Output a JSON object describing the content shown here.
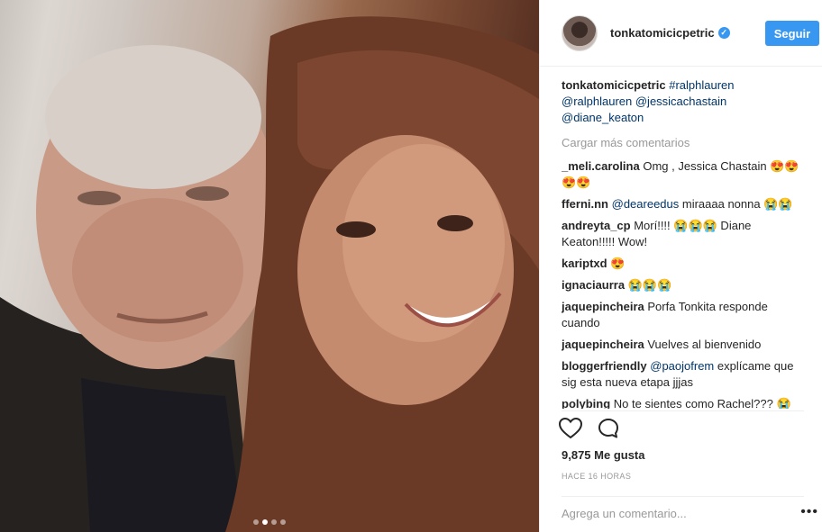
{
  "photo": {
    "carousel_dots": 4,
    "active_dot": 1
  },
  "header": {
    "username": "tonkatomicicpetric",
    "follow_label": "Seguir"
  },
  "caption": {
    "user": "tonkatomicicpetric",
    "tags": "#ralphlauren",
    "mentions": "@ralphlauren @jessicachastain @diane_keaton"
  },
  "load_more": "Cargar más comentarios",
  "comments": [
    {
      "user": "_meli.carolina",
      "text": " Omg , Jessica Chastain 😍😍😍😍"
    },
    {
      "user": "fferni.nn",
      "mention": "@deareedus",
      "text": " miraaaa nonna 😭😭"
    },
    {
      "user": "andreyta_cp",
      "text": " Morí!!!! 😭😭😭 Diane Keaton!!!!! Wow!"
    },
    {
      "user": "kariptxd",
      "text": " 😍"
    },
    {
      "user": "ignaciaurra",
      "text": " 😭😭😭"
    },
    {
      "user": "jaquepincheira",
      "text": " Porfa Tonkita responde cuando"
    },
    {
      "user": "jaquepincheira",
      "text": " Vuelves al bienvenido"
    },
    {
      "user": "bloggerfriendly",
      "mention": "@paojofrem",
      "text": " explícame que sig esta nueva etapa jjjas"
    },
    {
      "user": "polybing",
      "text": " No te sientes como Rachel??? 😭"
    }
  ],
  "actions": {
    "like_icon": "heart-outline-icon",
    "comment_icon": "speech-bubble-icon"
  },
  "likes": "9,875 Me gusta",
  "time": "HACE 16 HORAS",
  "add_comment": {
    "placeholder": "Agrega un comentario..."
  },
  "more_icon_glyph": "•••",
  "colors": {
    "accent": "#3897f0",
    "link": "#003569",
    "muted": "#999999"
  }
}
